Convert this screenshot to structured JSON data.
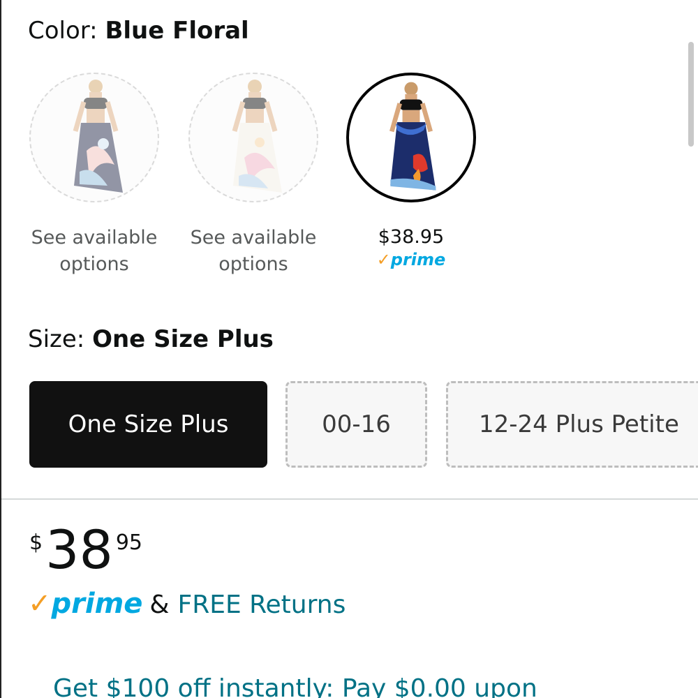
{
  "color": {
    "label": "Color: ",
    "selected": "Blue Floral",
    "swatches": [
      {
        "caption_line1": "See available",
        "caption_line2": "options",
        "image": "white-floral-skirt-dark-print",
        "available": false
      },
      {
        "caption_line1": "See available",
        "caption_line2": "options",
        "image": "white-floral-skirt-pastel-print",
        "available": false
      },
      {
        "price": "$38.95",
        "prime": "prime",
        "image": "navy-blue-floral-skirt",
        "available": true,
        "selected": true
      }
    ]
  },
  "size": {
    "label": "Size: ",
    "selected": "One Size Plus",
    "options": [
      {
        "label": "One Size Plus",
        "selected": true
      },
      {
        "label": "00-16",
        "selected": false
      },
      {
        "label": "12-24 Plus Petite",
        "selected": false
      }
    ]
  },
  "price": {
    "symbol": "$",
    "whole": "38",
    "fraction": "95"
  },
  "prime": {
    "check": "✓",
    "label": "prime",
    "amp": "&",
    "free_returns": "FREE Returns"
  },
  "promo": {
    "text": "Get $100 off instantly: Pay $0.00 upon"
  },
  "colors": {
    "prime_blue": "#00a8e1",
    "prime_check": "#f49e25",
    "link_teal": "#007185",
    "selected_bg": "#111111"
  }
}
